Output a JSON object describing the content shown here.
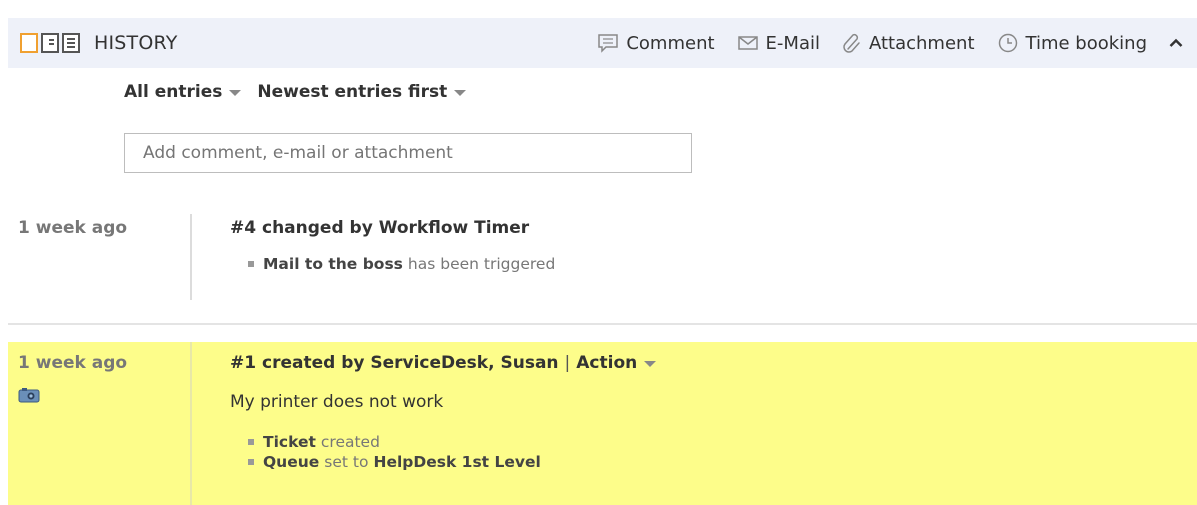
{
  "header": {
    "title": "HISTORY",
    "actions": {
      "comment": "Comment",
      "email": "E-Mail",
      "attachment": "Attachment",
      "time_booking": "Time booking"
    },
    "view_icons": [
      "view-single-icon",
      "view-split-icon",
      "view-list-icon"
    ],
    "accent_color": "#f0a030"
  },
  "filters": {
    "entries": "All entries",
    "order": "Newest entries first"
  },
  "comment_input": {
    "placeholder": "Add comment, e-mail or attachment"
  },
  "entries": [
    {
      "time": "1 week ago",
      "title": "#4 changed by Workflow Timer",
      "changes": [
        {
          "bold": "Mail to the boss",
          "text": "has been triggered"
        }
      ]
    },
    {
      "time": "1 week ago",
      "title": "#1 created by ServiceDesk, Susan",
      "separator": "|",
      "action": "Action",
      "text": "My printer does not work",
      "highlight_color": "#fdfd8a",
      "changes": [
        {
          "bold": "Ticket",
          "text": "created"
        },
        {
          "bold": "Queue",
          "text": "set to",
          "bold_after": "HelpDesk 1st Level"
        }
      ]
    }
  ]
}
